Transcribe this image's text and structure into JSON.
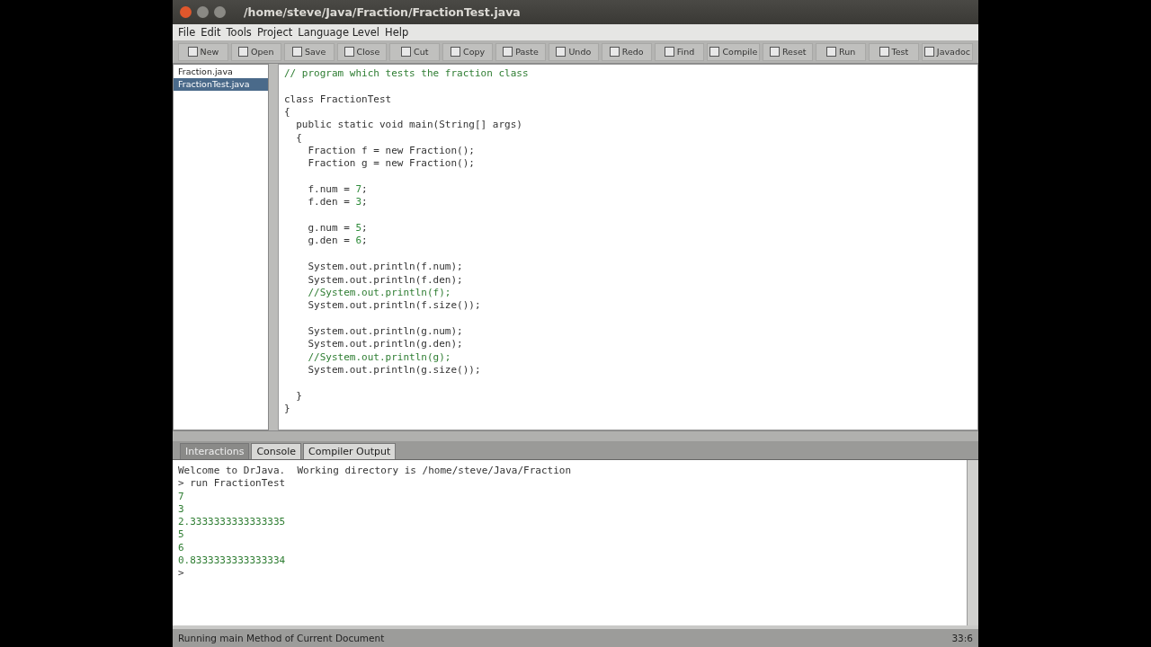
{
  "window": {
    "title": "/home/steve/Java/Fraction/FractionTest.java"
  },
  "menu": [
    "File",
    "Edit",
    "Tools",
    "Project",
    "Language Level",
    "Help"
  ],
  "toolbar": [
    {
      "label": "New"
    },
    {
      "label": "Open"
    },
    {
      "label": "Save"
    },
    {
      "label": "Close"
    },
    {
      "label": "Cut"
    },
    {
      "label": "Copy"
    },
    {
      "label": "Paste"
    },
    {
      "label": "Undo"
    },
    {
      "label": "Redo"
    },
    {
      "label": "Find"
    },
    {
      "label": "Compile"
    },
    {
      "label": "Reset"
    },
    {
      "label": "Run"
    },
    {
      "label": "Test"
    },
    {
      "label": "Javadoc"
    }
  ],
  "files": [
    {
      "name": "Fraction.java",
      "selected": false
    },
    {
      "name": "FractionTest.java",
      "selected": true
    }
  ],
  "code": [
    {
      "lines": [
        {
          "segments": [
            {
              "kind": "comment",
              "text": "// program which tests the fraction class"
            }
          ]
        }
      ]
    },
    {
      "lines": [
        {
          "segments": [
            {
              "kind": "plain",
              "text": "class FractionTest"
            }
          ]
        },
        {
          "segments": [
            {
              "kind": "plain",
              "text": "{"
            }
          ]
        },
        {
          "segments": [
            {
              "kind": "plain",
              "text": "  public static void main(String[] args)"
            }
          ]
        },
        {
          "segments": [
            {
              "kind": "plain",
              "text": "  {"
            }
          ]
        },
        {
          "segments": [
            {
              "kind": "plain",
              "text": "    Fraction f = new Fraction();"
            }
          ]
        },
        {
          "segments": [
            {
              "kind": "plain",
              "text": "    Fraction g = new Fraction();"
            }
          ]
        }
      ]
    },
    {
      "lines": [
        {
          "segments": [
            {
              "kind": "plain",
              "text": "    f.num = "
            },
            {
              "kind": "number",
              "text": "7"
            },
            {
              "kind": "plain",
              "text": ";"
            }
          ]
        },
        {
          "segments": [
            {
              "kind": "plain",
              "text": "    f.den = "
            },
            {
              "kind": "number",
              "text": "3"
            },
            {
              "kind": "plain",
              "text": ";"
            }
          ]
        }
      ]
    },
    {
      "lines": [
        {
          "segments": [
            {
              "kind": "plain",
              "text": "    g.num = "
            },
            {
              "kind": "number",
              "text": "5"
            },
            {
              "kind": "plain",
              "text": ";"
            }
          ]
        },
        {
          "segments": [
            {
              "kind": "plain",
              "text": "    g.den = "
            },
            {
              "kind": "number",
              "text": "6"
            },
            {
              "kind": "plain",
              "text": ";"
            }
          ]
        }
      ]
    },
    {
      "lines": [
        {
          "segments": [
            {
              "kind": "plain",
              "text": "    System.out.println(f.num);"
            }
          ]
        },
        {
          "segments": [
            {
              "kind": "plain",
              "text": "    System.out.println(f.den);"
            }
          ]
        },
        {
          "segments": [
            {
              "kind": "comment",
              "text": "    //System.out.println(f);"
            }
          ]
        },
        {
          "segments": [
            {
              "kind": "plain",
              "text": "    System.out.println(f.size());"
            }
          ]
        }
      ]
    },
    {
      "lines": [
        {
          "segments": [
            {
              "kind": "plain",
              "text": "    System.out.println(g.num);"
            }
          ]
        },
        {
          "segments": [
            {
              "kind": "plain",
              "text": "    System.out.println(g.den);"
            }
          ]
        },
        {
          "segments": [
            {
              "kind": "comment",
              "text": "    //System.out.println(g);"
            }
          ]
        },
        {
          "segments": [
            {
              "kind": "plain",
              "text": "    System.out.println(g.size());"
            }
          ]
        }
      ]
    },
    {
      "lines": [
        {
          "segments": [
            {
              "kind": "plain",
              "text": "  }"
            }
          ]
        },
        {
          "segments": [
            {
              "kind": "plain",
              "text": "}"
            }
          ]
        }
      ]
    }
  ],
  "tabs": [
    {
      "label": "Interactions",
      "selected": true
    },
    {
      "label": "Console",
      "selected": false
    },
    {
      "label": "Compiler Output",
      "selected": false
    }
  ],
  "console": [
    {
      "kind": "text",
      "text": "Welcome to DrJava.  Working directory is /home/steve/Java/Fraction"
    },
    {
      "kind": "text",
      "text": "> run FractionTest"
    },
    {
      "kind": "output",
      "text": "7"
    },
    {
      "kind": "output",
      "text": "3"
    },
    {
      "kind": "output",
      "text": "2.3333333333333335"
    },
    {
      "kind": "output",
      "text": "5"
    },
    {
      "kind": "output",
      "text": "6"
    },
    {
      "kind": "output",
      "text": "0.8333333333333334"
    },
    {
      "kind": "text",
      "text": ">"
    }
  ],
  "status_bar": {
    "message": "Running main Method of Current Document",
    "position": "33:6"
  }
}
